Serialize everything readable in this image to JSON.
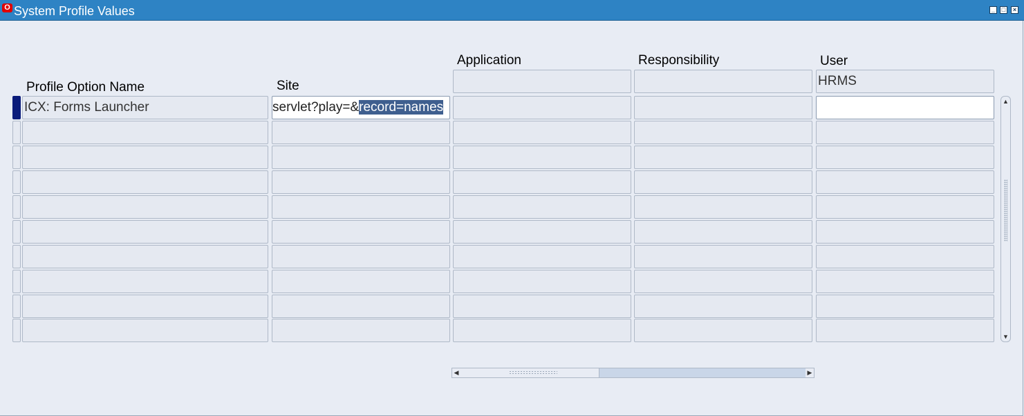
{
  "window": {
    "title": "System Profile Values",
    "app_icon": "oracle-logo-icon",
    "controls": [
      "minimize-icon",
      "maximize-icon",
      "close-icon"
    ]
  },
  "columns": {
    "profile_option_name": "Profile Option Name",
    "site": "Site",
    "application": "Application",
    "responsibility": "Responsibility",
    "user": "User"
  },
  "context": {
    "application": "",
    "responsibility": "",
    "user": "HRMS"
  },
  "rows": [
    {
      "profile_option_name": "ICX: Forms Launcher",
      "site_prefix": "servlet?play=&",
      "site_selected": "record=names",
      "application": "",
      "responsibility": "",
      "user": ""
    },
    {
      "profile_option_name": "",
      "application": "",
      "responsibility": "",
      "user": ""
    },
    {
      "profile_option_name": "",
      "application": "",
      "responsibility": "",
      "user": ""
    },
    {
      "profile_option_name": "",
      "application": "",
      "responsibility": "",
      "user": ""
    },
    {
      "profile_option_name": "",
      "application": "",
      "responsibility": "",
      "user": ""
    },
    {
      "profile_option_name": "",
      "application": "",
      "responsibility": "",
      "user": ""
    },
    {
      "profile_option_name": "",
      "application": "",
      "responsibility": "",
      "user": ""
    },
    {
      "profile_option_name": "",
      "application": "",
      "responsibility": "",
      "user": ""
    },
    {
      "profile_option_name": "",
      "application": "",
      "responsibility": "",
      "user": ""
    },
    {
      "profile_option_name": "",
      "application": "",
      "responsibility": "",
      "user": ""
    }
  ],
  "colors": {
    "titlebar": "#2e83c4",
    "background": "#e8ecf4",
    "current_record": "#0a1b7a",
    "selection": "#3f5f8f"
  }
}
